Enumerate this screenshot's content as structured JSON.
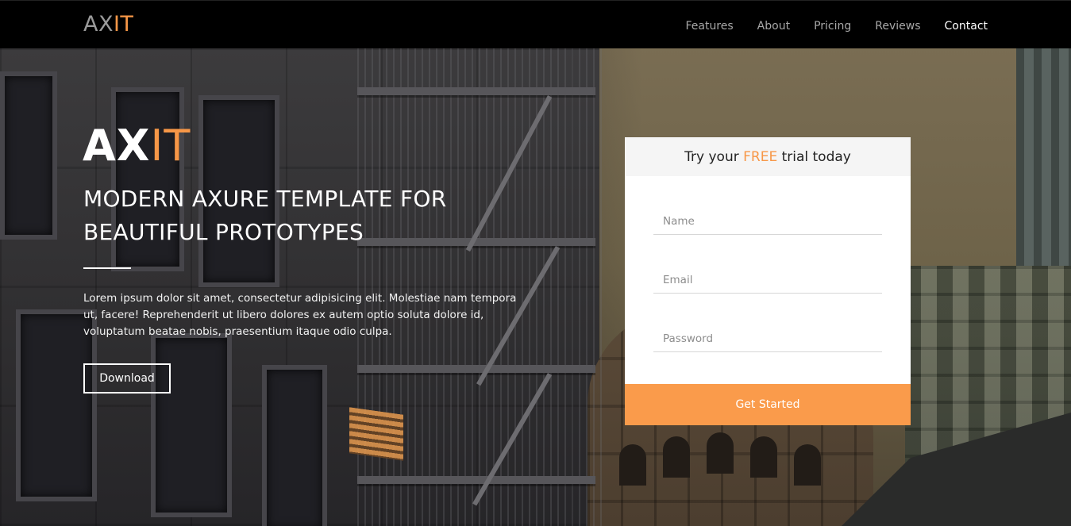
{
  "navbar": {
    "brand_a": "AX",
    "brand_b": "IT",
    "links": [
      {
        "label": "Features"
      },
      {
        "label": "About"
      },
      {
        "label": "Pricing"
      },
      {
        "label": "Reviews"
      },
      {
        "label": "Contact",
        "active": true
      }
    ]
  },
  "hero": {
    "logo_a": "AX",
    "logo_b": "IT",
    "headline": "MODERN AXURE TEMPLATE FOR BEAUTIFUL PROTOTYPES",
    "body": "Lorem ipsum dolor sit amet, consectetur adipisicing elit. Molestiae nam tempora ut, facere! Reprehenderit ut libero dolores ex autem optio soluta dolore id, voluptatum beatae nobis, praesentium itaque odio culpa.",
    "download_label": "Download"
  },
  "signup": {
    "title_pre": "Try your ",
    "title_free": "FREE",
    "title_post": " trial today",
    "name_placeholder": "Name",
    "email_placeholder": "Email",
    "password_placeholder": "Password",
    "submit_label": "Get Started"
  },
  "colors": {
    "accent": "#f79747",
    "navbar_bg": "#000000",
    "button_bg": "#fa9b4b"
  }
}
